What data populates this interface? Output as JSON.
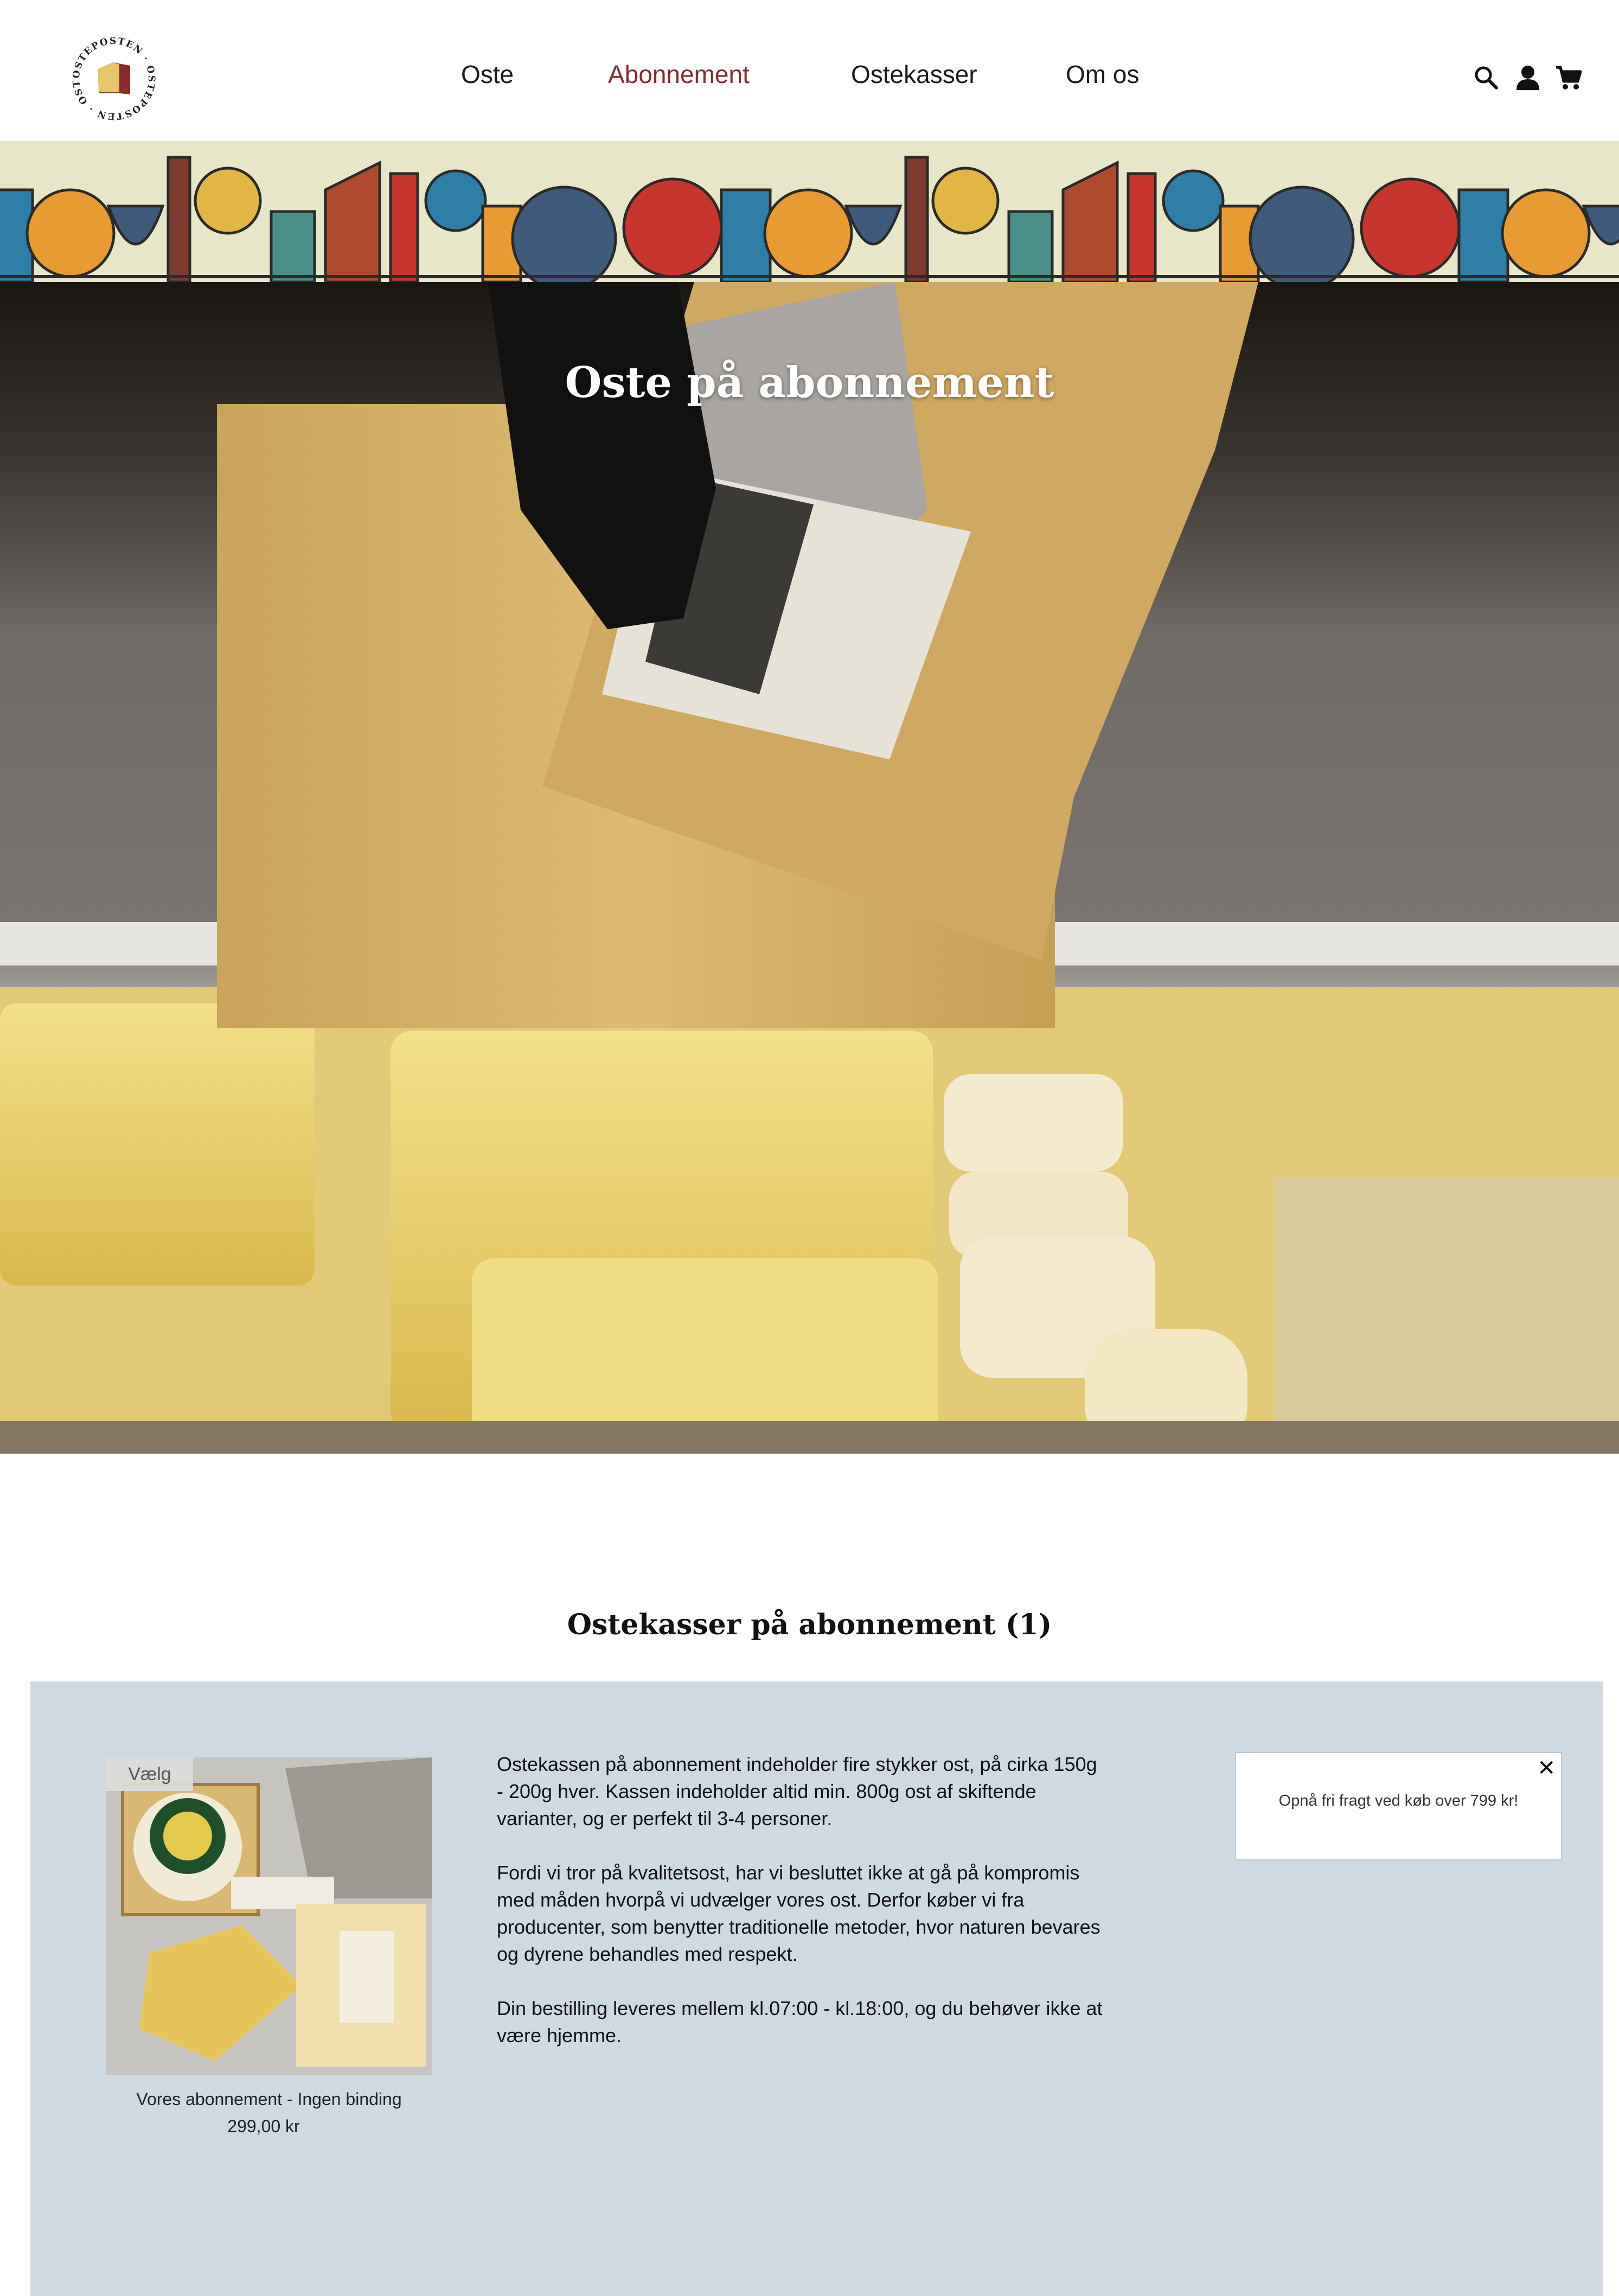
{
  "header": {
    "logo_text": "OSTEPOSTEN",
    "nav": [
      {
        "label": "Oste"
      },
      {
        "label": "Abonnement"
      },
      {
        "label": "Ostekasser"
      },
      {
        "label": "Om os"
      }
    ],
    "active_nav": "Abonnement",
    "icons": [
      "search-icon",
      "user-icon",
      "cart-icon"
    ]
  },
  "hero": {
    "title": "Oste på abonnement"
  },
  "section": {
    "title": "Ostekasser på abonnement (1)"
  },
  "product": {
    "badge": "Vælg",
    "name": "Vores abonnement - Ingen binding",
    "price": "299,00 kr"
  },
  "description": [
    "Ostekassen på abonnement indeholder fire stykker ost, på cirka 150g - 200g hver. Kassen indeholder altid min. 800g ost af skiftende varianter, og er perfekt til 3-4 personer.",
    "Fordi vi tror på kvalitetsost, har vi besluttet ikke at gå på kompromis med måden hvorpå vi udvælger vores ost. Derfor køber vi fra producenter, som benytter traditionelle metoder, hvor naturen bevares og dyrene behandles med respekt.",
    "Din bestilling leveres mellem kl.07:00 - kl.18:00, og du behøver ikke at være hjemme."
  ],
  "notice": {
    "text": "Opnå fri fragt ved køb over 799 kr!",
    "close": "✕"
  },
  "colors": {
    "accent": "#8a2a2d",
    "panel": "#cfd9e2"
  }
}
